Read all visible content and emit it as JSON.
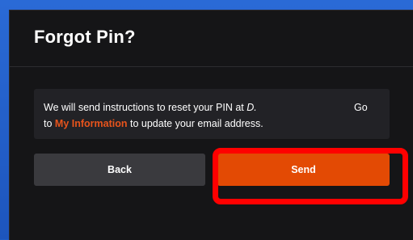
{
  "dialog": {
    "title": "Forgot Pin?",
    "message": {
      "line1_prefix": "We will send instructions to reset your PIN at",
      "email": "D.",
      "line1_suffix": "Go",
      "line2_prefix": "to",
      "link_label": "My Information",
      "line2_suffix": "to update your email address."
    },
    "buttons": {
      "back_label": "Back",
      "send_label": "Send"
    }
  },
  "colors": {
    "accent": "#e34a04",
    "link": "#e8541c",
    "annotation_highlight": "#ff0000"
  }
}
